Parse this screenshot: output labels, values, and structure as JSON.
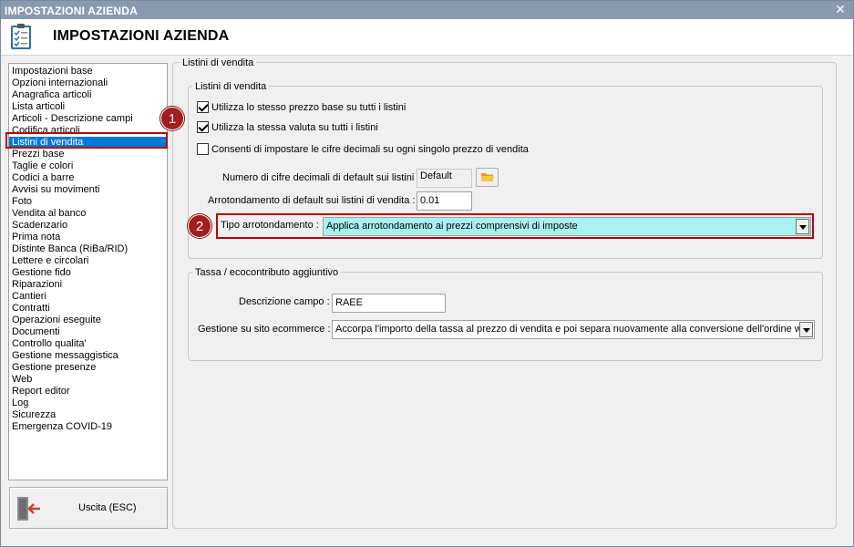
{
  "window": {
    "title": "IMPOSTAZIONI AZIENDA",
    "close_glyph": "✕"
  },
  "header": {
    "title": "IMPOSTAZIONI AZIENDA",
    "icon": "clipboard-checklist-icon"
  },
  "nav": {
    "items": [
      {
        "label": "Impostazioni base"
      },
      {
        "label": "Opzioni internazionali"
      },
      {
        "label": "Anagrafica articoli"
      },
      {
        "label": "Lista articoli"
      },
      {
        "label": "Articoli - Descrizione campi"
      },
      {
        "label": "Codifica articoli"
      },
      {
        "label": "Listini di vendita"
      },
      {
        "label": "Prezzi base"
      },
      {
        "label": "Taglie e colori"
      },
      {
        "label": "Codici a barre"
      },
      {
        "label": "Avvisi su movimenti"
      },
      {
        "label": "Foto"
      },
      {
        "label": "Vendita al banco"
      },
      {
        "label": "Scadenzario"
      },
      {
        "label": "Prima nota"
      },
      {
        "label": "Distinte Banca (RiBa/RID)"
      },
      {
        "label": "Lettere e circolari"
      },
      {
        "label": "Gestione fido"
      },
      {
        "label": "Riparazioni"
      },
      {
        "label": "Cantieri"
      },
      {
        "label": "Contratti"
      },
      {
        "label": "Operazioni eseguite"
      },
      {
        "label": "Documenti"
      },
      {
        "label": "Controllo qualita'"
      },
      {
        "label": "Gestione messaggistica"
      },
      {
        "label": "Gestione presenze"
      },
      {
        "label": "Web"
      },
      {
        "label": "Report editor"
      },
      {
        "label": "Log"
      },
      {
        "label": "Sicurezza"
      },
      {
        "label": "Emergenza COVID-19"
      }
    ],
    "selected": "Listini di vendita"
  },
  "exit_button": {
    "label": "Uscita (ESC)",
    "icon": "exit-door-icon"
  },
  "content": {
    "legend": "Listini di vendita",
    "listini_group": {
      "legend": "Listini di vendita",
      "chk_same_price": {
        "label": "Utilizza lo stesso prezzo base su tutti i listini",
        "checked": true
      },
      "chk_same_currency": {
        "label": "Utilizza la stessa valuta su tutti i listini",
        "checked": true
      },
      "chk_decimals": {
        "label": "Consenti di impostare le cifre decimali su ogni singolo prezzo di vendita",
        "checked": false
      },
      "decimals_label": "Numero di cifre decimali di default sui listini :",
      "decimals_value": "Default",
      "rounding_label": "Arrotondamento di default sui listini di vendita :",
      "rounding_value": "0.01",
      "rounding_type_label": "Tipo arrotondamento :",
      "rounding_type_value": "Applica arrotondamento ai prezzi comprensivi di imposte"
    },
    "tax_group": {
      "legend": "Tassa / ecocontributo aggiuntivo",
      "field_desc_label": "Descrizione campo :",
      "field_desc_value": "RAEE",
      "ecommerce_label": "Gestione su sito ecommerce :",
      "ecommerce_value": "Accorpa l'importo della tassa al prezzo di vendita e poi separa nuovamente alla conversione dell'ordine web"
    }
  },
  "annotations": {
    "badge1": "1",
    "badge2": "2",
    "highlight_color": "#c00000"
  },
  "colors": {
    "titlebar": "#8a9aae",
    "selection": "#0078d7",
    "cyan_select": "#aaf0f0"
  }
}
